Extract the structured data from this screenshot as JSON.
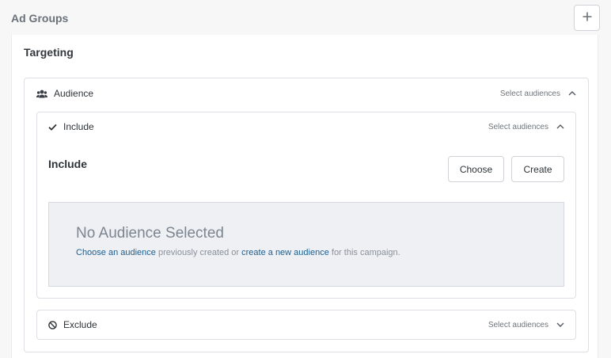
{
  "header": {
    "title": "Ad Groups",
    "add_icon": "plus-icon"
  },
  "targeting": {
    "title": "Targeting",
    "audience": {
      "label": "Audience",
      "icon": "users-icon",
      "right_label": "Select audiences",
      "include": {
        "label": "Include",
        "icon": "check-icon",
        "right_label": "Select audiences",
        "heading": "Include",
        "choose_label": "Choose",
        "create_label": "Create",
        "empty": {
          "title": "No Audience Selected",
          "link1": "Choose an audience",
          "text1": " previously created or ",
          "link2": "create a new audience",
          "text2": " for this campaign."
        }
      },
      "exclude": {
        "label": "Exclude",
        "icon": "ban-icon",
        "right_label": "Select audiences"
      }
    }
  },
  "colors": {
    "link": "#1a5f91",
    "empty_bg": "#eef0f4"
  }
}
